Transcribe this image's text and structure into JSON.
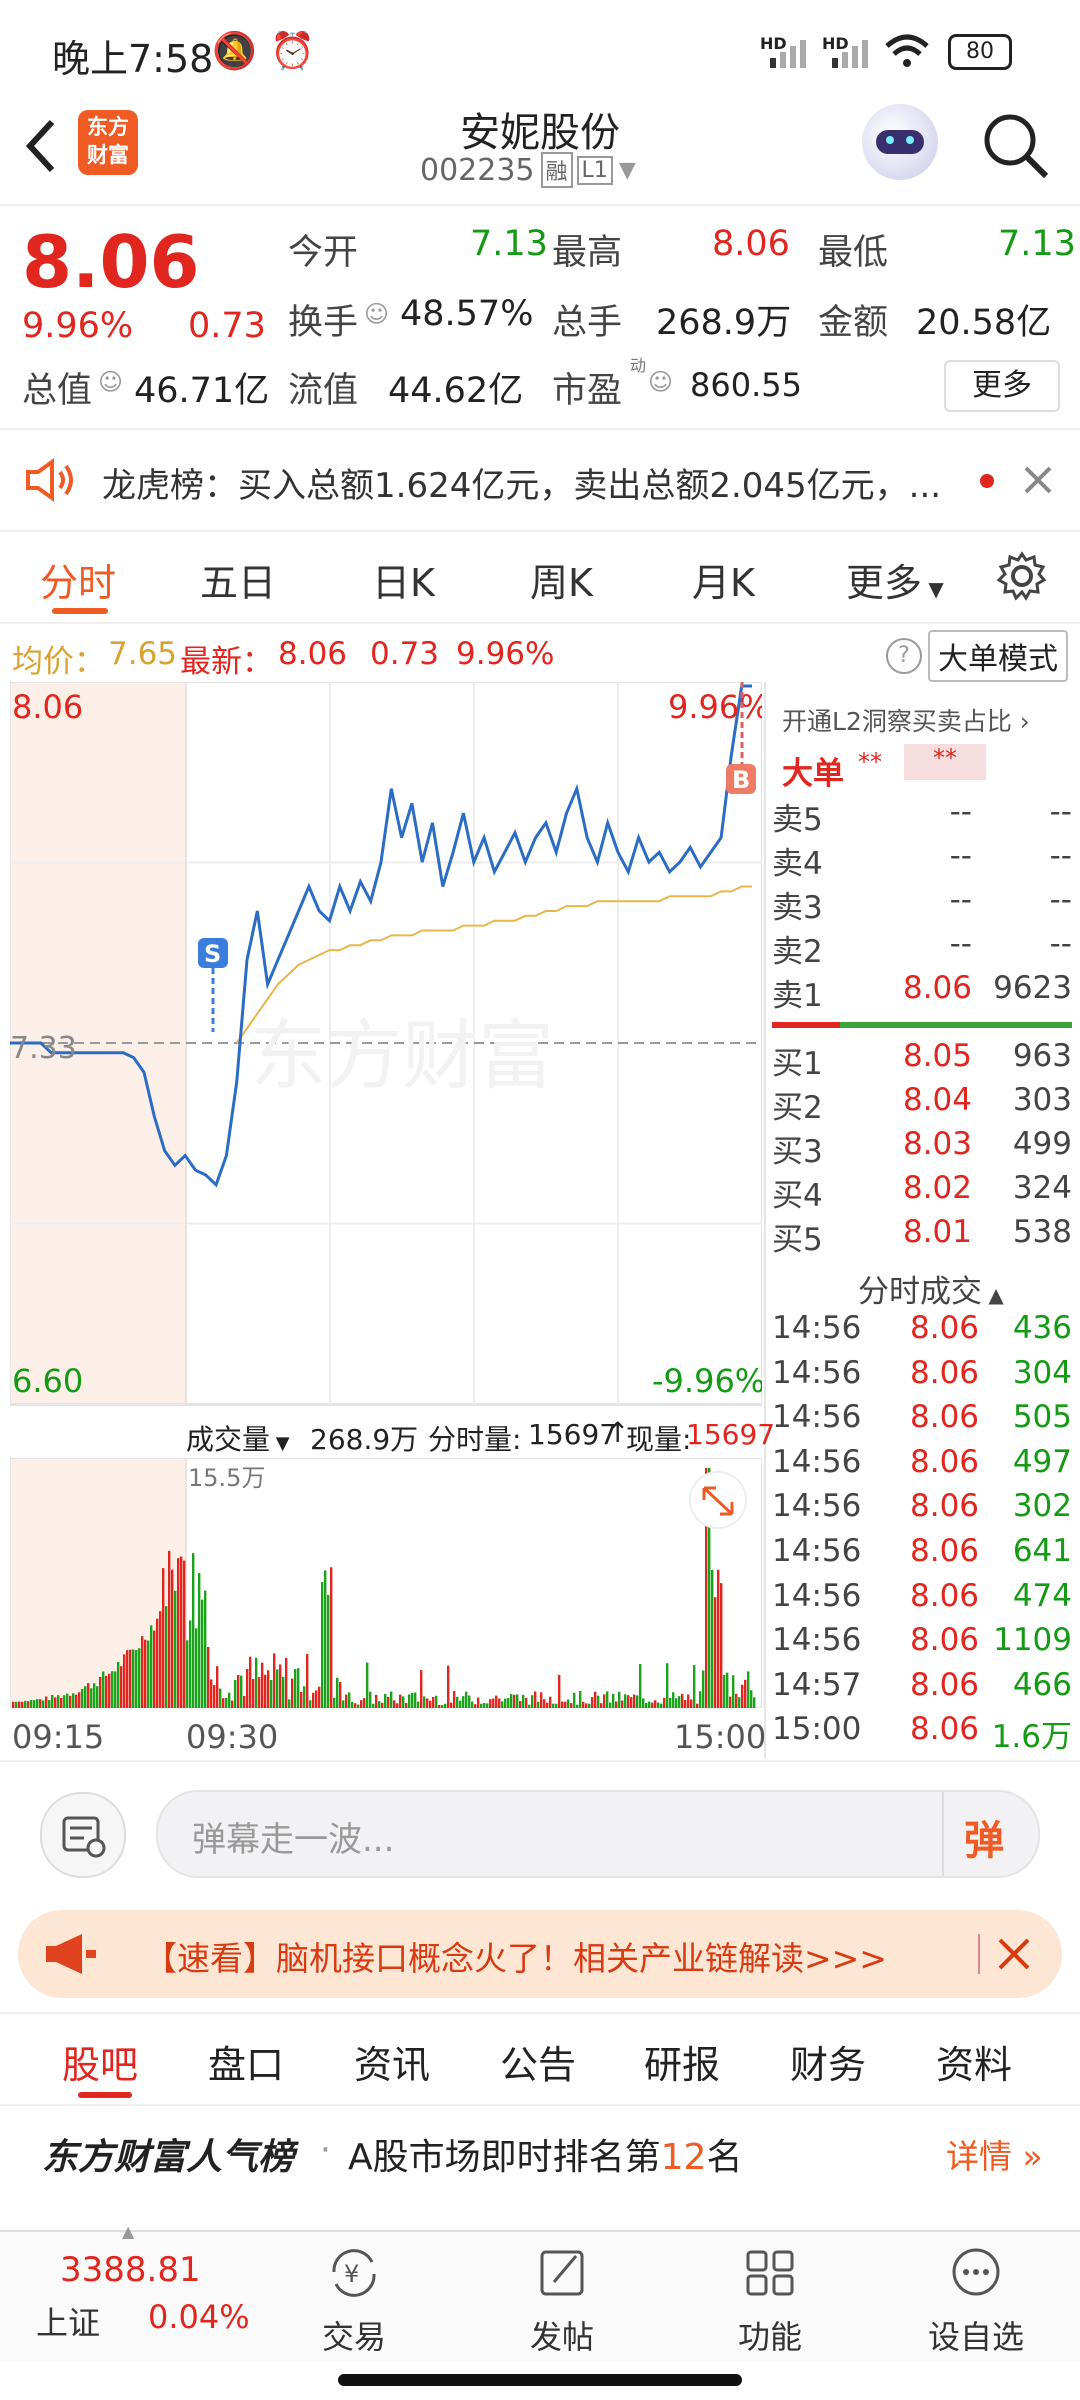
{
  "status_bar": {
    "time": "晚上7:58",
    "network_labels": [
      "HD",
      "HD"
    ],
    "battery": "80"
  },
  "header": {
    "logo_text": "东方财富",
    "stock_name": "安妮股份",
    "stock_code": "002235",
    "tag_margin": "融",
    "tag_level": "L1"
  },
  "quote": {
    "price": "8.06",
    "change_pct": "9.96%",
    "change": "0.73",
    "open_label": "今开",
    "open": "7.13",
    "high_label": "最高",
    "high": "8.06",
    "low_label": "最低",
    "low": "7.13",
    "turnover_label": "换手",
    "turnover": "48.57%",
    "volume_label": "总手",
    "volume": "268.9万",
    "amount_label": "金额",
    "amount": "20.58亿",
    "mktcap_label": "总值",
    "mktcap": "46.71亿",
    "float_label": "流值",
    "float_cap": "44.62亿",
    "pe_label": "市盈",
    "pe_sup": "动",
    "pe": "860.55",
    "more_button": "更多"
  },
  "notice": {
    "text": "龙虎榜：买入总额1.624亿元，卖出总额2.045亿元，..."
  },
  "tabs": [
    "分时",
    "五日",
    "日K",
    "周K",
    "月K",
    "更多"
  ],
  "chart_info": {
    "avg_label": "均价：",
    "avg": "7.65",
    "latest_label": "最新：",
    "latest": "8.06",
    "change": "0.73",
    "change_pct": "9.96%",
    "mode_button": "大单模式"
  },
  "chart_labels": {
    "top_price": "8.06",
    "top_pct": "9.96%",
    "mid_price": "7.33",
    "bottom_price": "6.60",
    "bottom_pct": "-9.96%",
    "watermark": "东方财富",
    "marker_s": "S",
    "marker_b": "B"
  },
  "chart_data": {
    "type": "line",
    "title": "",
    "ylim": [
      6.6,
      8.06
    ],
    "prev_close": 7.33,
    "series": [
      {
        "name": "",
        "color": "#2b6cc4",
        "values": [
          7.33,
          7.33,
          7.33,
          7.33,
          7.31,
          7.31,
          7.31,
          7.31,
          7.31,
          7.31,
          7.31,
          7.31,
          7.3,
          7.27,
          7.18,
          7.11,
          7.08,
          7.1,
          7.07,
          7.06,
          7.04,
          7.1,
          7.25,
          7.5,
          7.6,
          7.45,
          7.5,
          7.55,
          7.6,
          7.65,
          7.6,
          7.58,
          7.65,
          7.6,
          7.66,
          7.62,
          7.7,
          7.85,
          7.75,
          7.82,
          7.7,
          7.78,
          7.65,
          7.72,
          7.8,
          7.7,
          7.75,
          7.68,
          7.72,
          7.76,
          7.7,
          7.75,
          7.78,
          7.72,
          7.8,
          7.85,
          7.75,
          7.7,
          7.78,
          7.72,
          7.68,
          7.75,
          7.7,
          7.72,
          7.68,
          7.7,
          7.73,
          7.69,
          7.72,
          7.75,
          7.92,
          8.06,
          8.06
        ]
      },
      {
        "name": "",
        "color": "#e8b64a",
        "values": [
          null,
          null,
          null,
          null,
          null,
          null,
          null,
          null,
          null,
          null,
          null,
          null,
          null,
          null,
          null,
          null,
          null,
          null,
          null,
          null,
          null,
          null,
          7.33,
          7.36,
          7.39,
          7.42,
          7.45,
          7.47,
          7.49,
          7.5,
          7.51,
          7.52,
          7.52,
          7.53,
          7.53,
          7.54,
          7.54,
          7.55,
          7.55,
          7.55,
          7.56,
          7.56,
          7.56,
          7.56,
          7.57,
          7.57,
          7.57,
          7.58,
          7.58,
          7.58,
          7.59,
          7.59,
          7.6,
          7.6,
          7.61,
          7.61,
          7.61,
          7.62,
          7.62,
          7.62,
          7.62,
          7.62,
          7.62,
          7.62,
          7.63,
          7.63,
          7.63,
          7.63,
          7.63,
          7.64,
          7.64,
          7.65,
          7.65
        ]
      }
    ],
    "volume": {
      "total_label": "成交量",
      "total": "268.9万",
      "period_label": "分时量:",
      "period": "15697",
      "current_label": "现量:",
      "current": "15697",
      "max_label": "15.5万",
      "times": [
        "09:15",
        "09:30",
        "15:00"
      ]
    }
  },
  "orderbook": {
    "header": "开通L2洞察买卖占比",
    "big_label": "大单",
    "big_v1": "**",
    "big_v2": "**",
    "asks": [
      {
        "label": "卖5",
        "price": "--",
        "vol": "--"
      },
      {
        "label": "卖4",
        "price": "--",
        "vol": "--"
      },
      {
        "label": "卖3",
        "price": "--",
        "vol": "--"
      },
      {
        "label": "卖2",
        "price": "--",
        "vol": "--"
      },
      {
        "label": "卖1",
        "price": "8.06",
        "vol": "9623"
      }
    ],
    "bids": [
      {
        "label": "买1",
        "price": "8.05",
        "vol": "963"
      },
      {
        "label": "买2",
        "price": "8.04",
        "vol": "303"
      },
      {
        "label": "买3",
        "price": "8.03",
        "vol": "499"
      },
      {
        "label": "买4",
        "price": "8.02",
        "vol": "324"
      },
      {
        "label": "买5",
        "price": "8.01",
        "vol": "538"
      }
    ]
  },
  "trades": {
    "title": "分时成交",
    "rows": [
      {
        "time": "14:56",
        "price": "8.06",
        "vol": "436"
      },
      {
        "time": "14:56",
        "price": "8.06",
        "vol": "304"
      },
      {
        "time": "14:56",
        "price": "8.06",
        "vol": "505"
      },
      {
        "time": "14:56",
        "price": "8.06",
        "vol": "497"
      },
      {
        "time": "14:56",
        "price": "8.06",
        "vol": "302"
      },
      {
        "time": "14:56",
        "price": "8.06",
        "vol": "641"
      },
      {
        "time": "14:56",
        "price": "8.06",
        "vol": "474"
      },
      {
        "time": "14:56",
        "price": "8.06",
        "vol": "1109"
      },
      {
        "time": "14:57",
        "price": "8.06",
        "vol": "466"
      },
      {
        "time": "15:00",
        "price": "8.06",
        "vol": "1.6万"
      }
    ]
  },
  "danmu": {
    "placeholder": "弹幕走一波...",
    "send_label": "弹"
  },
  "promo": {
    "text": "【速看】脑机接口概念火了！相关产业链解读>>>"
  },
  "bottom_tabs": [
    "股吧",
    "盘口",
    "资讯",
    "公告",
    "研报",
    "财务",
    "资料"
  ],
  "rank": {
    "brand": "东方财富人气榜",
    "text_before": "A股市场即时排名第",
    "rank": "12",
    "text_after": "名",
    "detail": "详情"
  },
  "nav": {
    "index_value": "3388.81",
    "index_name": "上证",
    "index_change": "0.04%",
    "items": [
      "交易",
      "发帖",
      "功能",
      "设自选"
    ]
  }
}
